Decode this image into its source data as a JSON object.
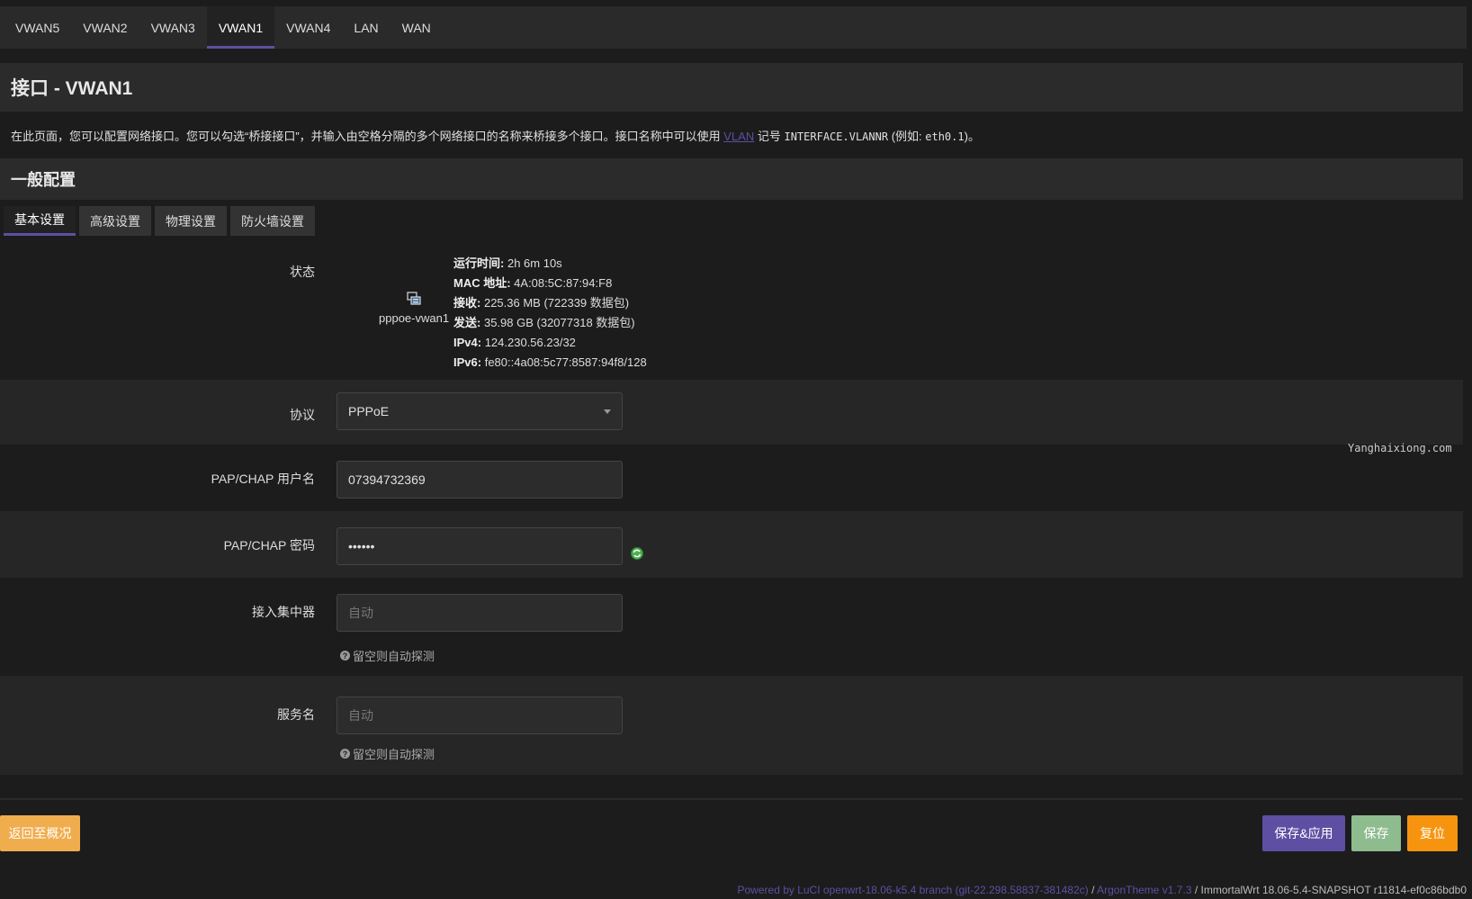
{
  "top_tabs": [
    "VWAN5",
    "VWAN2",
    "VWAN3",
    "VWAN1",
    "VWAN4",
    "LAN",
    "WAN"
  ],
  "active_tab": "VWAN1",
  "page_title": "接口 - VWAN1",
  "description": {
    "text_before": "在此页面，您可以配置网络接口。您可以勾选“桥接接口”，并输入由空格分隔的多个网络接口的名称来桥接多个接口。接口名称中可以使用 ",
    "link": "VLAN",
    "text_middle": " 记号 ",
    "code1": "INTERFACE.VLANNR",
    "text_paren": " (例如: ",
    "code2": "eth0.1",
    "text_end": ")。"
  },
  "section_title": "一般配置",
  "sub_tabs": [
    "基本设置",
    "高级设置",
    "物理设置",
    "防火墙设置"
  ],
  "status": {
    "label": "状态",
    "interface_name": "pppoe-vwan1",
    "uptime_label": "运行时间:",
    "uptime": "2h 6m 10s",
    "mac_label": "MAC 地址:",
    "mac": "4A:08:5C:87:94:F8",
    "rx_label": "接收:",
    "rx": "225.36 MB (722339 数据包)",
    "tx_label": "发送:",
    "tx": "35.98 GB (32077318 数据包)",
    "ipv4_label": "IPv4:",
    "ipv4": "124.230.56.23/32",
    "ipv6_label": "IPv6:",
    "ipv6": "fe80::4a08:5c77:8587:94f8/128"
  },
  "protocol": {
    "label": "协议",
    "value": "PPPoE"
  },
  "username": {
    "label": "PAP/CHAP 用户名",
    "value": "07394732369"
  },
  "password": {
    "label": "PAP/CHAP 密码",
    "value": "••••••"
  },
  "concentrator": {
    "label": "接入集中器",
    "placeholder": "自动",
    "hint": "留空则自动探测"
  },
  "service": {
    "label": "服务名",
    "placeholder": "自动",
    "hint": "留空则自动探测"
  },
  "watermark": "Yanghaixiong.com",
  "buttons": {
    "back": "返回至概况",
    "save_apply": "保存&应用",
    "save": "保存",
    "reset": "复位"
  },
  "footer": {
    "luci": "Powered by LuCI openwrt-18.06-k5.4 branch (git-22.298.58837-381482c)",
    "sep": " / ",
    "theme": "ArgonTheme v1.7.3",
    "firmware": "ImmortalWrt 18.06-5.4-SNAPSHOT r11814-ef0c86bdb0"
  },
  "colors": {
    "accent": "#5e4fa2",
    "warning": "#f0ad4e",
    "success": "#8fbc8f",
    "reset": "#f7940f"
  }
}
